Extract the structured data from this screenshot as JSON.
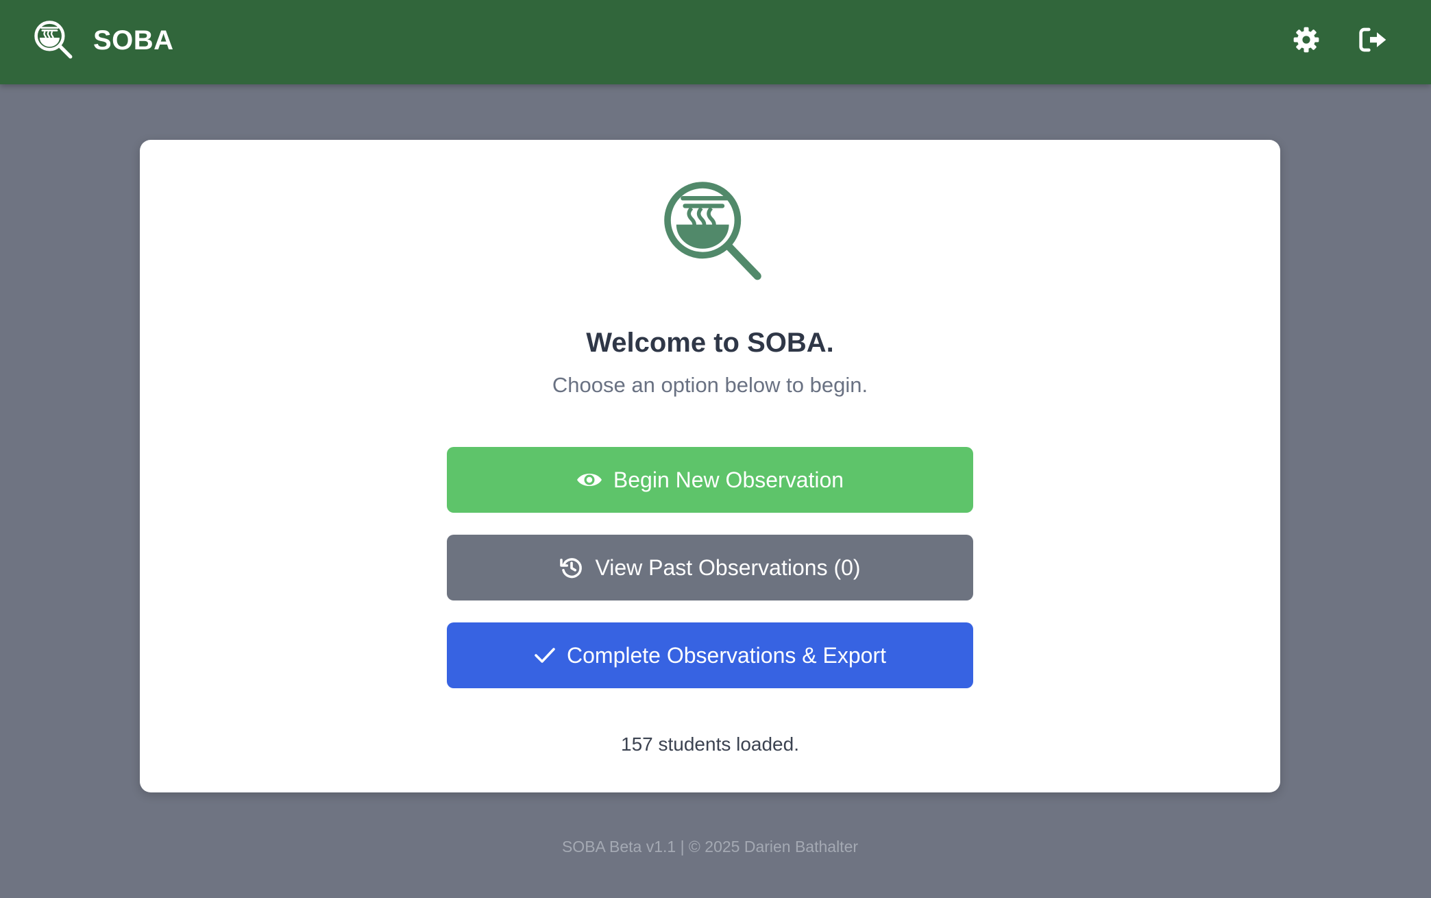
{
  "header": {
    "app_name": "SOBA",
    "logo_icon": "soba-bowl-magnifier-logo-icon",
    "settings_icon": "gear-icon",
    "logout_icon": "logout-icon",
    "bar_color": "#31663b"
  },
  "main": {
    "logo_icon": "soba-bowl-magnifier-logo-icon",
    "title": "Welcome to SOBA.",
    "subtitle": "Choose an option below to begin.",
    "buttons": [
      {
        "label": "Begin New Observation",
        "icon": "eye-icon",
        "color": "#5ec46a"
      },
      {
        "label": "View Past Observations (0)",
        "icon": "history-icon",
        "color": "#6d7380"
      },
      {
        "label": "Complete Observations & Export",
        "icon": "check-icon",
        "color": "#3763e2"
      }
    ],
    "status": "157 students loaded."
  },
  "footer": {
    "text": "SOBA Beta v1.1 | © 2025 Darien Bathalter"
  }
}
